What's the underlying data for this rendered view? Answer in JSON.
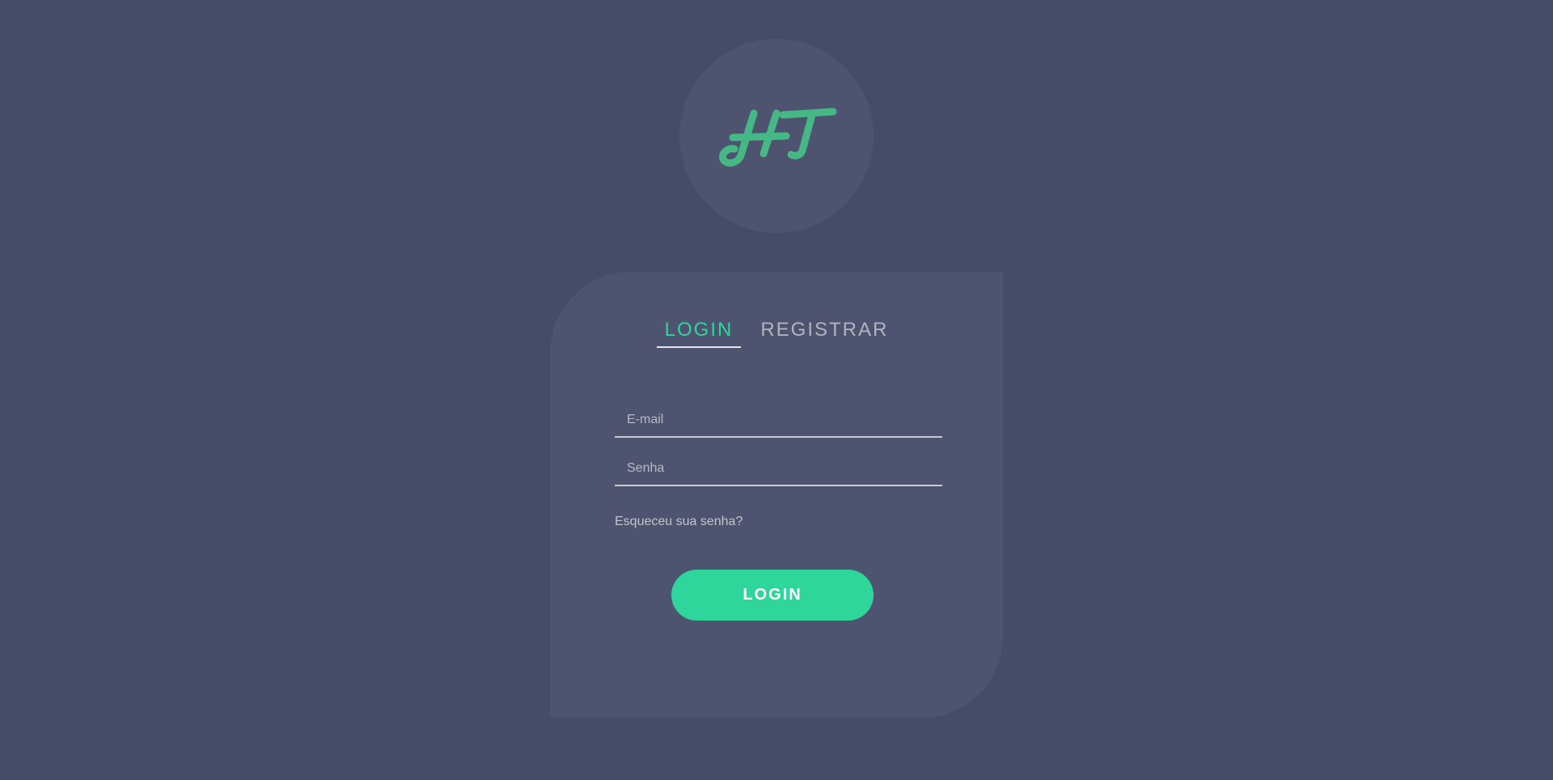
{
  "logo": {
    "text": "HT",
    "color": "#46b886"
  },
  "tabs": [
    {
      "label": "LOGIN",
      "active": true
    },
    {
      "label": "REGISTRAR",
      "active": false
    }
  ],
  "form": {
    "email_placeholder": "E-mail",
    "email_value": "",
    "password_placeholder": "Senha",
    "password_value": "",
    "forgot_label": "Esqueceu sua senha?",
    "submit_label": "LOGIN"
  },
  "colors": {
    "background": "#464c67",
    "card": "#4e5470",
    "accent": "#2ed69c",
    "muted_text": "#b3b3be"
  }
}
